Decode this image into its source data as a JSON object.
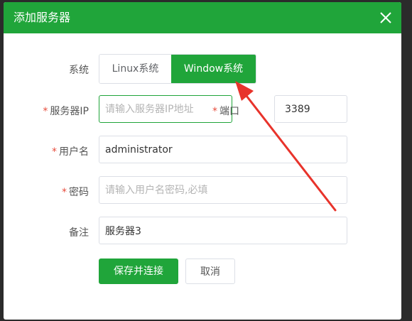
{
  "dialog": {
    "title": "添加服务器",
    "close_icon": "close-icon"
  },
  "form": {
    "system": {
      "label": "系统",
      "options": [
        "Linux系统",
        "Window系统"
      ],
      "selected": "Window系统"
    },
    "server_ip": {
      "required_mark": "*",
      "label": "服务器IP",
      "value": "",
      "placeholder": "请输入服务器IP地址"
    },
    "port": {
      "required_mark": "*",
      "label": "端口",
      "value": "3389"
    },
    "username": {
      "required_mark": "*",
      "label": "用户名",
      "value": "administrator"
    },
    "password": {
      "required_mark": "*",
      "label": "密码",
      "value": "",
      "placeholder": "请输入用户名密码,必填"
    },
    "remark": {
      "label": "备注",
      "value": "服务器3"
    }
  },
  "buttons": {
    "save_connect": "保存并连接",
    "cancel": "取消"
  },
  "colors": {
    "accent": "#20a53a",
    "required": "#e74c3c",
    "annotation_arrow": "#e8332b"
  }
}
